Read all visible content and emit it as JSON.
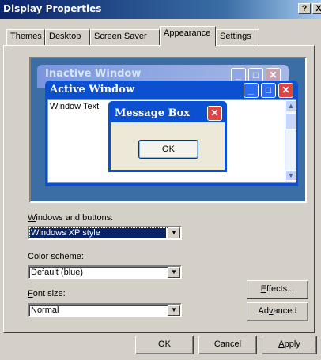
{
  "window": {
    "title": "Display Properties",
    "help_button": "?",
    "close_button": "X"
  },
  "tabs": [
    {
      "label": "Themes"
    },
    {
      "label": "Desktop"
    },
    {
      "label": "Screen Saver"
    },
    {
      "label": "Appearance"
    },
    {
      "label": "Settings"
    }
  ],
  "preview": {
    "inactive_caption": "Inactive Window",
    "active_caption": "Active Window",
    "window_text": "Window Text",
    "message_box_caption": "Message Box",
    "ok_label": "OK",
    "colors": {
      "desktop": "#3a6ea5",
      "active_title": "#0a50d0",
      "close_button": "#e04343"
    }
  },
  "windows_buttons": {
    "label_access": "W",
    "label_rest": "indows and buttons:",
    "value": "Windows XP style"
  },
  "color_scheme": {
    "label": "Color scheme:",
    "value": "Default (blue)"
  },
  "font_size": {
    "label_access": "F",
    "label_rest": "ont size:",
    "value": "Normal"
  },
  "effects_button": {
    "access": "E",
    "rest": "ffects..."
  },
  "advanced_button": {
    "pre": "Ad",
    "access": "v",
    "post": "anced"
  },
  "footer": {
    "ok_label": "OK",
    "cancel_label": "Cancel",
    "apply_access": "A",
    "apply_rest": "pply"
  }
}
